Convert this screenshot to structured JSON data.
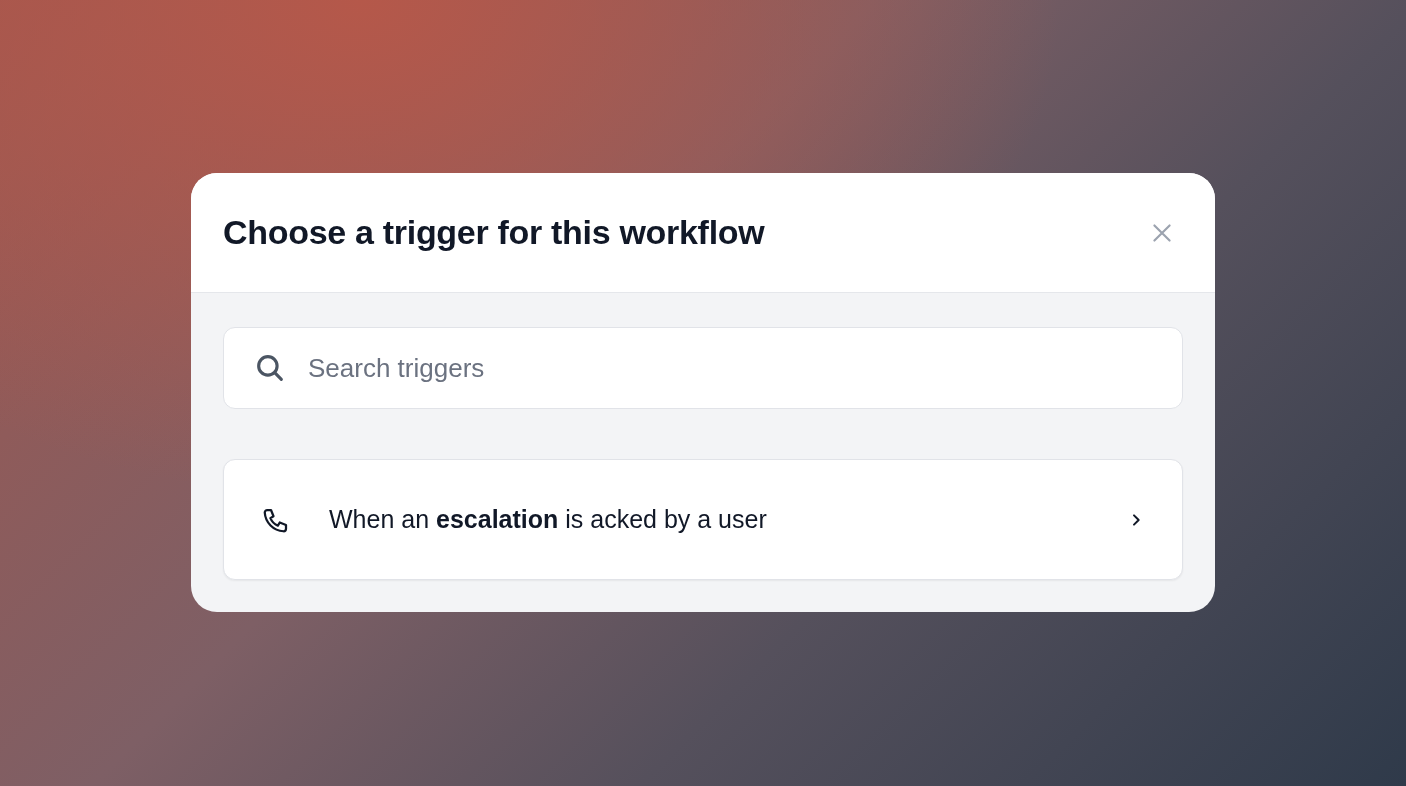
{
  "dialog": {
    "title": "Choose a trigger for this workflow",
    "search": {
      "placeholder": "Search triggers"
    },
    "triggers": [
      {
        "kind": "phone",
        "label": "When an **escalation** is acked by a user"
      }
    ]
  }
}
